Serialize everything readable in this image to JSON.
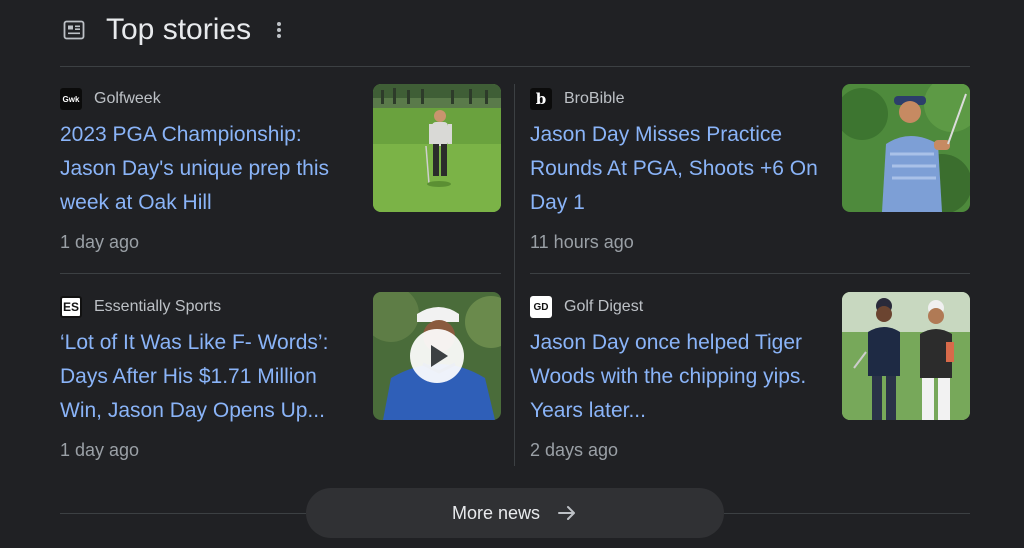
{
  "header": {
    "title": "Top stories",
    "icon": "newspaper-icon",
    "menu_icon": "more-vert-icon"
  },
  "stories": [
    {
      "source": "Golfweek",
      "logo_text": "Gwk",
      "headline": "2023 PGA Championship: Jason Day's unique prep this week at Oak Hill",
      "time": "1 day ago"
    },
    {
      "source": "BroBible",
      "logo_text": "b",
      "headline": "Jason Day Misses Practice Rounds At PGA, Shoots +6 On Day 1",
      "time": "11 hours ago"
    },
    {
      "source": "Essentially Sports",
      "logo_text": "ES",
      "headline": "‘Lot of It Was Like F- Words’: Days After His $1.71 Million Win, Jason Day Opens Up...",
      "time": "1 day ago",
      "has_video": true
    },
    {
      "source": "Golf Digest",
      "logo_text": "GD",
      "headline": "Jason Day once helped Tiger Woods with the chipping yips. Years later...",
      "time": "2 days ago"
    }
  ],
  "more_button": {
    "label": "More news",
    "icon": "arrow-right-icon"
  },
  "colors": {
    "background": "#202124",
    "headline": "#8ab4f8",
    "divider": "#3c4043"
  }
}
